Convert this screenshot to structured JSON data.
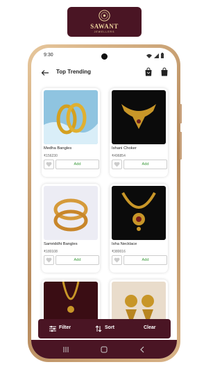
{
  "brand": {
    "name": "SAWANT",
    "tagline": "JEWELLERS"
  },
  "status_bar": {
    "time": "9:30"
  },
  "header": {
    "title": "Top Trending"
  },
  "products": [
    {
      "name": "Medha Bangles",
      "price": "₹156230",
      "add_label": "Add"
    },
    {
      "name": "Ishani Choker",
      "price": "₹496854",
      "add_label": "Add"
    },
    {
      "name": "Samriddhi Bangles",
      "price": "₹180108",
      "add_label": "Add"
    },
    {
      "name": "Isha Necklace",
      "price": "₹380016",
      "add_label": "Add"
    }
  ],
  "bottom_bar": {
    "filter_label": "Filter",
    "sort_label": "Sort",
    "clear_label": "Clear"
  },
  "colors": {
    "brand": "#4a1524",
    "gold": "#e8cf9a",
    "add_text": "#3a9a3a"
  },
  "icons": [
    "back-arrow-icon",
    "shopping-bag-icon",
    "filter-icon",
    "sort-icon",
    "heart-icon",
    "wifi-icon",
    "signal-icon",
    "battery-icon"
  ]
}
